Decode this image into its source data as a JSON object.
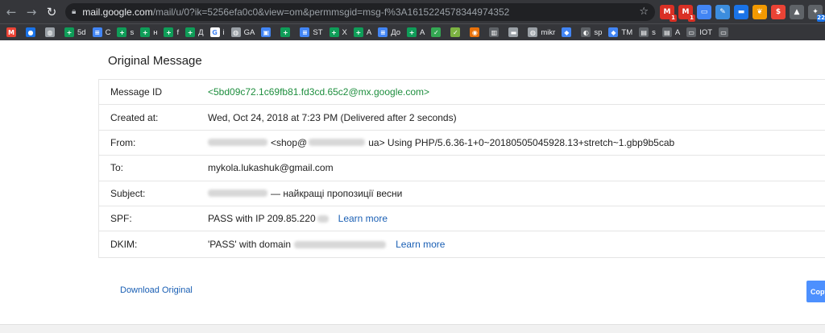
{
  "browser": {
    "url_host": "mail.google.com",
    "url_rest": "/mail/u/0?ik=5256efa0c0&view=om&permmsgid=msg-f%3A1615224578344974352",
    "extensions": [
      {
        "icon": "gmail-icon",
        "color": "#d93025",
        "glyph": "M",
        "badge": "1"
      },
      {
        "icon": "mail-checker-icon",
        "color": "#d93025",
        "glyph": "M",
        "badge": "1"
      },
      {
        "icon": "screen-icon",
        "color": "#4285f4",
        "glyph": "▭",
        "badge": ""
      },
      {
        "icon": "note-icon",
        "color": "#3c8dde",
        "glyph": "✎",
        "badge": ""
      },
      {
        "icon": "chat-icon",
        "color": "#1a73e8",
        "glyph": "▬",
        "badge": ""
      },
      {
        "icon": "leaf-icon",
        "color": "#f29900",
        "glyph": "❦",
        "badge": ""
      },
      {
        "icon": "dollar-icon",
        "color": "#ea4335",
        "glyph": "$",
        "badge": ""
      },
      {
        "icon": "drive-icon",
        "color": "#5f6368",
        "glyph": "▲",
        "badge": ""
      },
      {
        "icon": "puzzle-icon",
        "color": "#5f6368",
        "glyph": "✦",
        "badge": "22"
      }
    ],
    "bookmarks": [
      {
        "icon": "gmail-icon",
        "color": "#ea4335",
        "glyph": "M",
        "label": ""
      },
      {
        "icon": "contacts-icon",
        "color": "#1a73e8",
        "glyph": "●",
        "label": ""
      },
      {
        "icon": "globe-icon",
        "color": "#9aa0a6",
        "glyph": "◍",
        "label": ""
      },
      {
        "icon": "sheets-icon",
        "color": "#0f9d58",
        "glyph": "+",
        "label": "5d"
      },
      {
        "icon": "docs-icon",
        "color": "#4285f4",
        "glyph": "≡",
        "label": "C"
      },
      {
        "icon": "sheets-icon",
        "color": "#0f9d58",
        "glyph": "+",
        "label": "s"
      },
      {
        "icon": "sheets-icon",
        "color": "#0f9d58",
        "glyph": "+",
        "label": "н"
      },
      {
        "icon": "sheets-icon",
        "color": "#0f9d58",
        "glyph": "+",
        "label": "f"
      },
      {
        "icon": "sheets-icon",
        "color": "#0f9d58",
        "glyph": "+",
        "label": "Д"
      },
      {
        "icon": "google-icon",
        "color": "#ffffff",
        "glyph": "G",
        "label": "i"
      },
      {
        "icon": "globe-icon",
        "color": "#9aa0a6",
        "glyph": "◍",
        "label": "GA"
      },
      {
        "icon": "image-icon",
        "color": "#4285f4",
        "glyph": "▣",
        "label": ""
      },
      {
        "icon": "sheets-icon",
        "color": "#0f9d58",
        "glyph": "+",
        "label": ""
      },
      {
        "icon": "docs-icon",
        "color": "#4285f4",
        "glyph": "≡",
        "label": "ST"
      },
      {
        "icon": "sheets-icon",
        "color": "#0f9d58",
        "glyph": "+",
        "label": "X"
      },
      {
        "icon": "sheets-icon",
        "color": "#0f9d58",
        "glyph": "+",
        "label": "A"
      },
      {
        "icon": "docs-icon",
        "color": "#4285f4",
        "glyph": "≡",
        "label": "До"
      },
      {
        "icon": "sheets-icon",
        "color": "#0f9d58",
        "glyph": "+",
        "label": "A"
      },
      {
        "icon": "check-icon",
        "color": "#34a853",
        "glyph": "✓",
        "label": ""
      },
      {
        "icon": "check-icon",
        "color": "#7cb342",
        "glyph": "✓",
        "label": ""
      },
      {
        "icon": "firefox-icon",
        "color": "#e8710a",
        "glyph": "◉",
        "label": ""
      },
      {
        "icon": "bin-icon",
        "color": "#5f6368",
        "glyph": "▥",
        "label": ""
      },
      {
        "icon": "car-icon",
        "color": "#9aa0a6",
        "glyph": "▬",
        "label": ""
      },
      {
        "icon": "globe-icon",
        "color": "#9aa0a6",
        "glyph": "◍",
        "label": "mikr"
      },
      {
        "icon": "pin-icon",
        "color": "#4285f4",
        "glyph": "◆",
        "label": ""
      },
      {
        "icon": "sp-icon",
        "color": "#5f6368",
        "glyph": "◐",
        "label": "sp"
      },
      {
        "icon": "diamond-icon",
        "color": "#4285f4",
        "glyph": "◆",
        "label": "TM"
      },
      {
        "icon": "folder-icon",
        "color": "#5f6368",
        "glyph": "▤",
        "label": "s"
      },
      {
        "icon": "folder-icon",
        "color": "#5f6368",
        "glyph": "▤",
        "label": "A"
      },
      {
        "icon": "folder-icon",
        "color": "#5f6368",
        "glyph": "▭",
        "label": "IOT"
      },
      {
        "icon": "folder-icon",
        "color": "#5f6368",
        "glyph": "▭",
        "label": ""
      }
    ]
  },
  "page": {
    "heading": "Original Message",
    "download_label": "Download Original",
    "copy_label": "Copy",
    "learn_more": "Learn more"
  },
  "rows": {
    "message_id": {
      "label": "Message ID",
      "value": "<5bd09c72.1c69fb81.fd3cd.65c2@mx.google.com>"
    },
    "created": {
      "label": "Created at:",
      "value": "Wed, Oct 24, 2018 at 7:23 PM (Delivered after 2 seconds)"
    },
    "from": {
      "label": "From:",
      "part1": "<shop@",
      "part2": "ua> Using PHP/5.6.36-1+0~20180505045928.13+stretch~1.gbp9b5cab"
    },
    "to": {
      "label": "To:",
      "value": "mykola.lukashuk@gmail.com"
    },
    "subject": {
      "label": "Subject:",
      "value": "— найкращі пропозиції весни"
    },
    "spf": {
      "label": "SPF:",
      "value": "PASS with IP 209.85.220"
    },
    "dkim": {
      "label": "DKIM:",
      "value": "'PASS' with domain"
    }
  }
}
